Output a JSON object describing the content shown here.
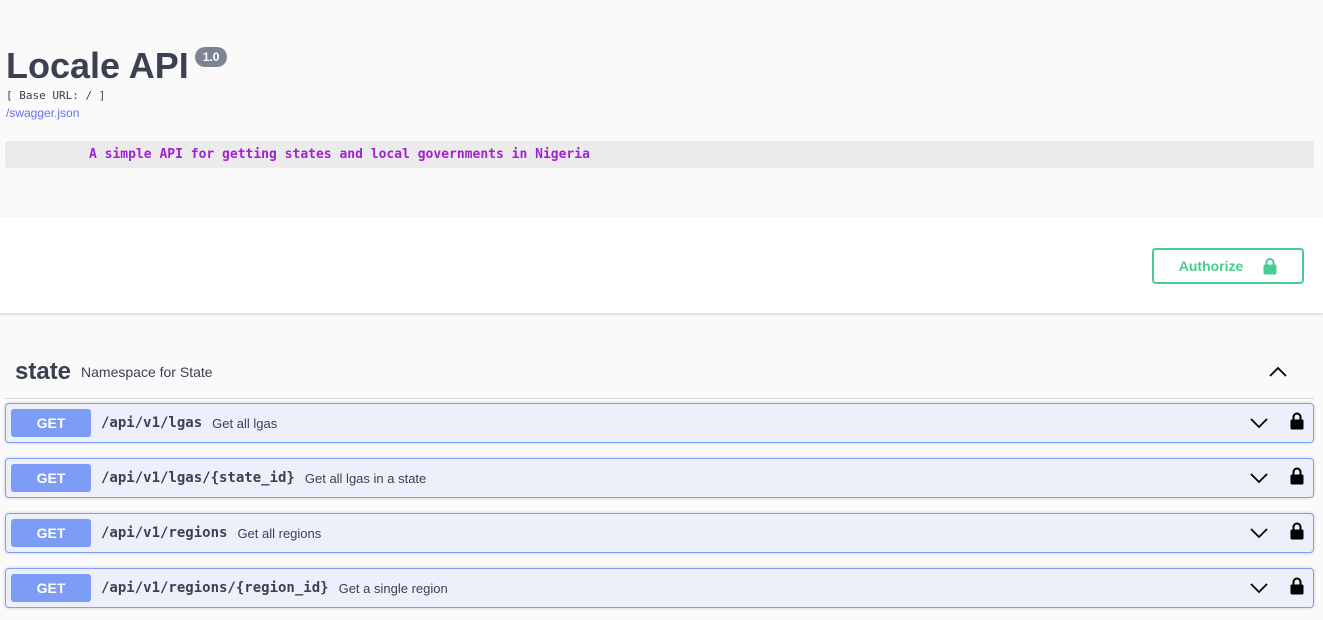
{
  "info": {
    "title": "Locale API",
    "version": "1.0",
    "base_url": "[ Base URL: / ]",
    "spec_link": "/swagger.json",
    "description": "A simple API for getting states and local governments in Nigeria"
  },
  "auth": {
    "authorize_label": "Authorize",
    "icon": "lock-open-icon"
  },
  "tag": {
    "name": "state",
    "description": "Namespace for State",
    "expanded": true
  },
  "operations": [
    {
      "method": "GET",
      "path": "/api/v1/lgas",
      "summary": "Get all lgas"
    },
    {
      "method": "GET",
      "path": "/api/v1/lgas/{state_id}",
      "summary": "Get all lgas in a state"
    },
    {
      "method": "GET",
      "path": "/api/v1/regions",
      "summary": "Get all regions"
    },
    {
      "method": "GET",
      "path": "/api/v1/regions/{region_id}",
      "summary": "Get a single region"
    }
  ],
  "colors": {
    "get_method": "#7c9cf5",
    "authorize": "#49cc90",
    "description_text": "#a31fd6"
  }
}
